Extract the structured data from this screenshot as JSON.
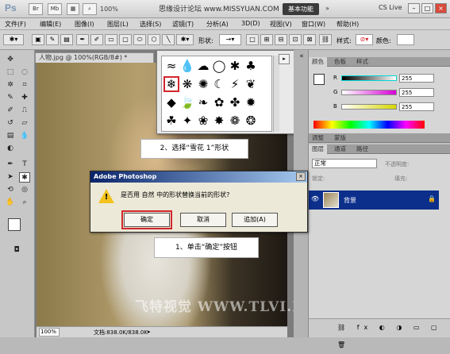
{
  "appbar": {
    "logo": "Ps",
    "buttons": [
      "Br",
      "Mb"
    ],
    "zoom": "100%",
    "watermark": "思缘设计论坛 www.MISSYUAN.COM",
    "workspace": "基本功能",
    "cslive": "CS Live",
    "win_buttons": [
      "–",
      "□",
      "×"
    ]
  },
  "menubar": {
    "items": [
      "文件(F)",
      "编辑(E)",
      "图像(I)",
      "图层(L)",
      "选择(S)",
      "滤镜(T)",
      "分析(A)",
      "3D(D)",
      "视图(V)",
      "窗口(W)",
      "帮助(H)"
    ]
  },
  "options": {
    "shape_label": "形状:",
    "style_label": "样式:",
    "color_label": "颜色:"
  },
  "document": {
    "tab_title": "人物.jpg @ 100%(RGB/8#) *",
    "zoom": "100%",
    "doc_info": "文档:838.0K/838.0K"
  },
  "shape_picker": {
    "shapes": [
      "≈",
      "💧",
      "☁",
      "◯",
      "✱",
      "♣",
      "❋",
      "❄",
      "✺",
      "☾",
      "⚡",
      "❦",
      "◆",
      "♦",
      "❧",
      "✿",
      "✤",
      "⬣",
      "☘",
      "✹",
      "✷",
      "🍃",
      "❀",
      "✦",
      "✸",
      "✺",
      "❁",
      "❂"
    ]
  },
  "panels": {
    "color_tabs": [
      "颜色",
      "色板",
      "样式"
    ],
    "adjust_tabs": [
      "调整",
      "蒙版"
    ],
    "layer_tabs": [
      "图层",
      "通道",
      "路径"
    ],
    "blend_mode": "正常",
    "opacity_label": "不透明度:",
    "lock_label": "锁定:",
    "fill_label": "填充:",
    "layer_name": "背景",
    "sliders": [
      {
        "label": "R",
        "value": "255",
        "color": "#00d7d7"
      },
      {
        "label": "G",
        "value": "255",
        "color": "#d700d7"
      },
      {
        "label": "B",
        "value": "255",
        "color": "#d7d700"
      }
    ]
  },
  "callouts": {
    "step2": "2、选择“雪花 1”形状",
    "step1": "1、单击“确定”按钮"
  },
  "dialog": {
    "title": "Adobe Photoshop",
    "message": "是否用 自然 中的形状替换当前的形状?",
    "ok": "确定",
    "cancel": "取消",
    "append": "追加(A)",
    "close": "×"
  },
  "bottom_watermark": "飞特视觉 WWW.TLVI.NET"
}
